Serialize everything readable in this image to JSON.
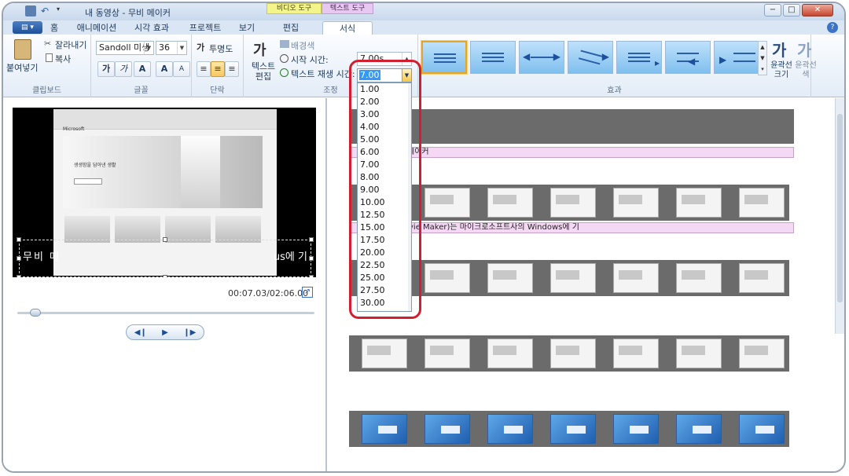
{
  "window": {
    "title": "내 동영상 - 무비 메이커",
    "context_tab_video": "비디오 도구",
    "context_tab_text": "텍스트 도구",
    "minimize": "−",
    "maximize": "□",
    "close": "✕",
    "app_button": "▤ ▾"
  },
  "tabs": [
    {
      "label": "홈"
    },
    {
      "label": "애니메이션"
    },
    {
      "label": "시각 효과"
    },
    {
      "label": "프로젝트"
    },
    {
      "label": "보기"
    },
    {
      "label": "편집"
    },
    {
      "label": "서식"
    }
  ],
  "ribbon": {
    "clipboard": {
      "paste": "붙여넣기",
      "cut": "잘라내기",
      "copy": "복사",
      "label": "클립보드"
    },
    "font": {
      "family": "Sandoll 미생",
      "size": "36",
      "bold": "가",
      "italic": "가",
      "color": "A",
      "grow": "A",
      "shrink": "A",
      "label": "글꼴"
    },
    "paragraph": {
      "transparency": "투명도",
      "label": "단락"
    },
    "adjust": {
      "text_edit": "텍스트 편집",
      "background": "배경색",
      "start_time": "시작 시간:",
      "duration": "텍스트 재생 시간:",
      "start_value": "7.00s",
      "label": "조정"
    },
    "effects": {
      "label": "효과",
      "outline_size": "윤곽선 크기",
      "outline_color": "윤곽선 색"
    }
  },
  "dropdown": {
    "current": "7.00",
    "options": [
      "1.00",
      "2.00",
      "3.00",
      "4.00",
      "5.00",
      "6.00",
      "7.00",
      "8.00",
      "9.00",
      "10.00",
      "12.50",
      "15.00",
      "17.50",
      "20.00",
      "22.50",
      "25.00",
      "27.50",
      "30.00"
    ]
  },
  "preview": {
    "timecode": "00:07.03/02:06.00",
    "caption_left": "무비 메",
    "caption_right": "us에 기",
    "hero_text": "생생함을 담아낸 생활",
    "brand": "Microsoft"
  },
  "storyboard": {
    "caption1": "메이커",
    "caption2": "vie Maker)는 마이크로소프트사의 Windows에 기"
  },
  "colors": {
    "highlight": "#d21e2e",
    "selection": "#3399ff",
    "caption_bg": "#f4d8f4"
  }
}
